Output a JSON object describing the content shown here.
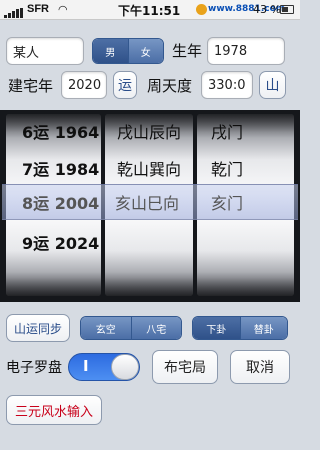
{
  "status_bar": {
    "carrier": "SFR",
    "time": "下午11:51",
    "website": "www.8881.com",
    "battery": "43 %"
  },
  "form": {
    "name_value": "某人",
    "gender_options": [
      "男",
      "女"
    ],
    "birth_year_label": "生年",
    "birth_year_value": "1978",
    "build_year_label": "建宅年",
    "build_year_value": "2020",
    "yun_button": "运",
    "degree_label": "周天度",
    "degree_value": "330:0",
    "mountain_button": "山"
  },
  "picker": {
    "col1": [
      "6运 1964",
      "7运 1984",
      "8运 2004",
      "9运 2024"
    ],
    "col2": [
      "戌山辰向",
      "乾山巽向",
      "亥山巳向",
      ""
    ],
    "col3": [
      "戌门",
      "乾门",
      "亥门",
      ""
    ],
    "selected_index": 2
  },
  "controls": {
    "sync_button": "山运同步",
    "mode_segment": [
      "玄空",
      "八宅"
    ],
    "gua_segment": [
      "下卦",
      "替卦"
    ],
    "compass_label": "电子罗盘",
    "compass_toggle": "I",
    "layout_button": "布宅局",
    "cancel_button": "取消",
    "input_button": "三元风水输入"
  }
}
